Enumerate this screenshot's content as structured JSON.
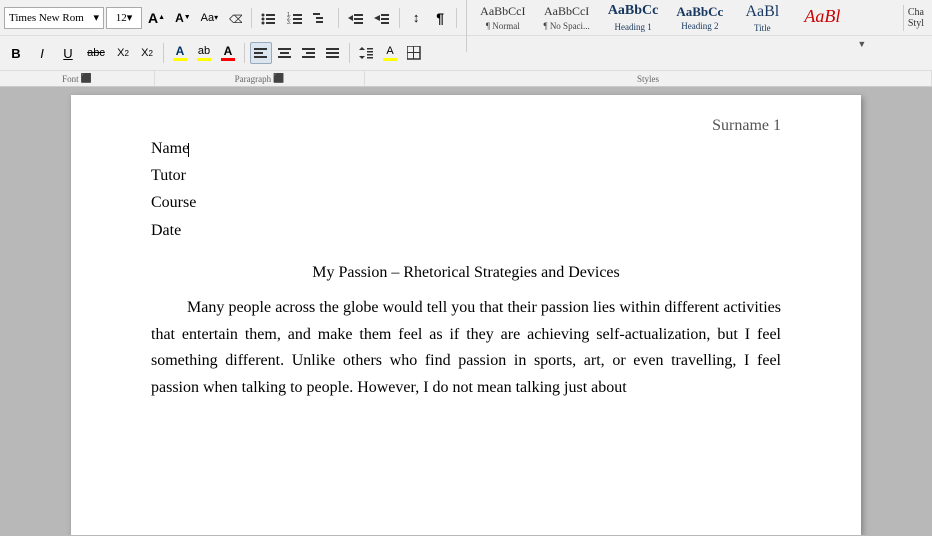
{
  "toolbar": {
    "font_name": "Times New Rom",
    "font_size": "12",
    "font_increase_label": "A",
    "font_decrease_label": "A",
    "change_case_label": "Aa",
    "clear_format_label": "⌫",
    "bold_label": "B",
    "italic_label": "I",
    "underline_label": "U",
    "strikethrough_label": "abc",
    "subscript_label": "X₂",
    "superscript_label": "X²",
    "text_highlight_label": "A",
    "text_color_label": "A",
    "bullets_label": "≡",
    "numbering_label": "≡",
    "multilevel_label": "≡",
    "decrease_indent_label": "←≡",
    "increase_indent_label": "→≡",
    "sort_label": "↕",
    "show_marks_label": "¶",
    "align_left_label": "≡",
    "align_center_label": "≡",
    "align_right_label": "≡",
    "justify_label": "≡",
    "line_spacing_label": "↕",
    "shading_label": "A",
    "borders_label": "⊞",
    "font_section_label": "Font",
    "paragraph_section_label": "Paragraph",
    "styles_section_label": "Styles"
  },
  "styles": {
    "items": [
      {
        "id": "normal",
        "preview": "AaBbCcI",
        "label": "¶ Normal"
      },
      {
        "id": "nospace",
        "preview": "AaBbCcI",
        "label": "¶ No Spaci..."
      },
      {
        "id": "h1",
        "preview": "AaBbCc",
        "label": "Heading 1"
      },
      {
        "id": "h2",
        "preview": "AaBbCc",
        "label": "Heading 2"
      },
      {
        "id": "title",
        "preview": "AaBl",
        "label": "Title"
      },
      {
        "id": "extra",
        "preview": "AaBl",
        "label": ""
      }
    ]
  },
  "document": {
    "header_text": "Surname 1",
    "field_name": "Name",
    "field_tutor": "Tutor",
    "field_course": "Course",
    "field_date": "Date",
    "title": "My Passion – Rhetorical Strategies and Devices",
    "paragraph1": "Many people across the globe would tell you that their passion lies within different activities that entertain them, and make them feel as if they are achieving self-actualization, but I feel something different. Unlike others who find passion in sports, art, or even travelling, I feel passion when talking to people. However, I do not mean talking just about"
  }
}
